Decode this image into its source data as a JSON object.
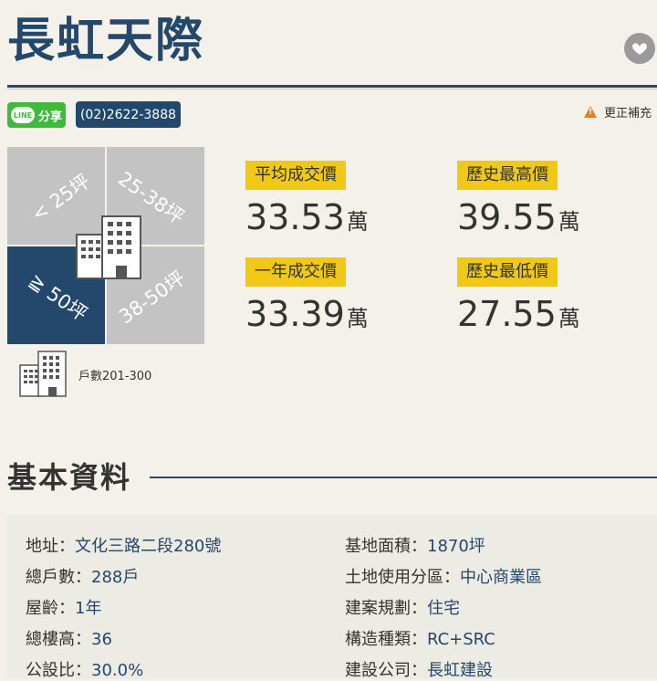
{
  "header": {
    "title": "長虹天際",
    "favorite_icon": "heart-icon"
  },
  "actions": {
    "share_label": "分享",
    "line_badge": "LINE",
    "phone": "(02)2622-3888",
    "correction_label": "更正補充"
  },
  "size_grid": {
    "cells": [
      {
        "label": "< 25坪",
        "active": false
      },
      {
        "label": "25-38坪",
        "active": false
      },
      {
        "label": "≧ 50坪",
        "active": true
      },
      {
        "label": "38-50坪",
        "active": false
      }
    ],
    "units_label": "戶數201-300"
  },
  "stats": {
    "avg_price": {
      "label": "平均成交價",
      "value": "33.53",
      "unit": "萬"
    },
    "hist_high": {
      "label": "歷史最高價",
      "value": "39.55",
      "unit": "萬"
    },
    "year_price": {
      "label": "一年成交價",
      "value": "33.39",
      "unit": "萬"
    },
    "hist_low": {
      "label": "歷史最低價",
      "value": "27.55",
      "unit": "萬"
    }
  },
  "basic": {
    "heading": "基本資料",
    "left": [
      {
        "key": "地址：",
        "value": "文化三路二段280號"
      },
      {
        "key": "總戶數：",
        "value": "288戶"
      },
      {
        "key": "屋齡：",
        "value": "1年"
      },
      {
        "key": "總樓高：",
        "value": "36"
      },
      {
        "key": "公設比：",
        "value": "30.0%"
      }
    ],
    "right": [
      {
        "key": "基地面積：",
        "value": "1870坪"
      },
      {
        "key": "土地使用分區：",
        "value": "中心商業區"
      },
      {
        "key": "建案規劃：",
        "value": "住宅"
      },
      {
        "key": "構造種類：",
        "value": "RC+SRC"
      },
      {
        "key": "建設公司：",
        "value": "長虹建設"
      }
    ]
  },
  "colors": {
    "primary": "#24486b",
    "highlight": "#f1c816",
    "line_green": "#3fba3b",
    "background": "#f3f1ea"
  }
}
